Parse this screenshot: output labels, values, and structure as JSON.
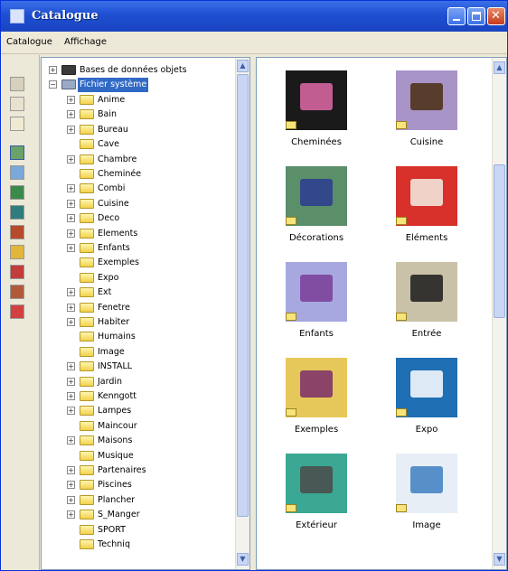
{
  "window": {
    "title": "Catalogue"
  },
  "menu": {
    "items": [
      "Catalogue",
      "Affichage"
    ]
  },
  "toolbar": {
    "icons": [
      "folder-up-icon",
      "list-view-icon",
      "filter-icon",
      "catalogue-icon",
      "textures-icon",
      "images-icon",
      "objects-icon",
      "paint-icon",
      "colors-icon",
      "doors-icon",
      "furniture-icon",
      "materials-icon"
    ]
  },
  "tree": {
    "root_items": [
      {
        "label": "Bases de données objets"
      },
      {
        "label": "Fichier système"
      }
    ],
    "folders": [
      {
        "label": "Anime",
        "expandable": true
      },
      {
        "label": "Bain",
        "expandable": true
      },
      {
        "label": "Bureau",
        "expandable": true
      },
      {
        "label": "Cave",
        "expandable": false
      },
      {
        "label": "Chambre",
        "expandable": true
      },
      {
        "label": "Cheminée",
        "expandable": false
      },
      {
        "label": "Combi",
        "expandable": true
      },
      {
        "label": "Cuisine",
        "expandable": true
      },
      {
        "label": "Deco",
        "expandable": true
      },
      {
        "label": "Elements",
        "expandable": true
      },
      {
        "label": "Enfants",
        "expandable": true
      },
      {
        "label": "Exemples",
        "expandable": false
      },
      {
        "label": "Expo",
        "expandable": false
      },
      {
        "label": "Ext",
        "expandable": true
      },
      {
        "label": "Fenetre",
        "expandable": true
      },
      {
        "label": "Habiter",
        "expandable": true
      },
      {
        "label": "Humains",
        "expandable": false
      },
      {
        "label": "Image",
        "expandable": false
      },
      {
        "label": "INSTALL",
        "expandable": true
      },
      {
        "label": "Jardin",
        "expandable": true
      },
      {
        "label": "Kenngott",
        "expandable": true
      },
      {
        "label": "Lampes",
        "expandable": true
      },
      {
        "label": "Maincour",
        "expandable": false
      },
      {
        "label": "Maisons",
        "expandable": true
      },
      {
        "label": "Musique",
        "expandable": false
      },
      {
        "label": "Partenaires",
        "expandable": true
      },
      {
        "label": "Piscines",
        "expandable": true
      },
      {
        "label": "Plancher",
        "expandable": true
      },
      {
        "label": "S_Manger",
        "expandable": true
      },
      {
        "label": "SPORT",
        "expandable": false
      },
      {
        "label": "Techniq",
        "expandable": false
      }
    ]
  },
  "thumbnails": [
    {
      "label": "Cheminées",
      "bg": "#1a1a1a",
      "fg": "#e06aa8"
    },
    {
      "label": "Cuisine",
      "bg": "#a994c8",
      "fg": "#4a2e12"
    },
    {
      "label": "Décorations",
      "bg": "#5a8f6a",
      "fg": "#2b3c8f"
    },
    {
      "label": "Eléments",
      "bg": "#d8302a",
      "fg": "#f4efe5"
    },
    {
      "label": "Enfants",
      "bg": "#a8a8e0",
      "fg": "#7a3d96"
    },
    {
      "label": "Entrée",
      "bg": "#c9c2a8",
      "fg": "#1b1b1b"
    },
    {
      "label": "Exemples",
      "bg": "#e6c85a",
      "fg": "#7a2b6a"
    },
    {
      "label": "Expo",
      "bg": "#1e6fb3",
      "fg": "#ffffff"
    },
    {
      "label": "Extérieur",
      "bg": "#3aa892",
      "fg": "#4a4a4a"
    },
    {
      "label": "Image",
      "bg": "#e7eef6",
      "fg": "#3d7fc1"
    }
  ],
  "colors": {
    "titlebar": "#1e4fd1",
    "selection": "#316ac5"
  }
}
